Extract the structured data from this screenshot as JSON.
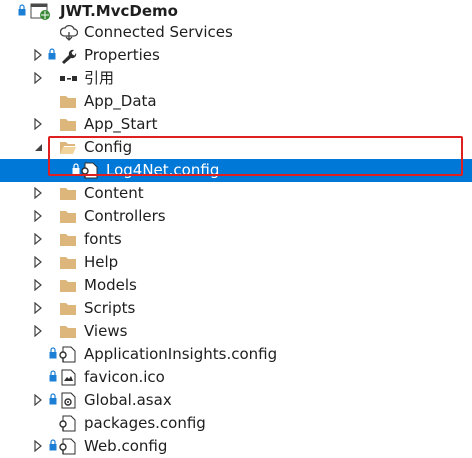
{
  "tree": {
    "root": "JWT.MvcDemo",
    "items": [
      {
        "label": "Connected Services",
        "icon": "connected-services-icon"
      },
      {
        "label": "Properties",
        "icon": "wrench-icon"
      },
      {
        "label": "引用",
        "icon": "references-icon"
      },
      {
        "label": "App_Data",
        "icon": "folder-icon"
      },
      {
        "label": "App_Start",
        "icon": "folder-icon"
      },
      {
        "label": "Config",
        "icon": "folder-open-icon",
        "expanded": true
      },
      {
        "label": "Log4Net.config",
        "icon": "config-file-icon",
        "selected": true
      },
      {
        "label": "Content",
        "icon": "folder-icon"
      },
      {
        "label": "Controllers",
        "icon": "folder-icon"
      },
      {
        "label": "fonts",
        "icon": "folder-icon"
      },
      {
        "label": "Help",
        "icon": "folder-icon"
      },
      {
        "label": "Models",
        "icon": "folder-icon"
      },
      {
        "label": "Scripts",
        "icon": "folder-icon"
      },
      {
        "label": "Views",
        "icon": "folder-icon"
      },
      {
        "label": "ApplicationInsights.config",
        "icon": "config-file-icon"
      },
      {
        "label": "favicon.ico",
        "icon": "image-file-icon"
      },
      {
        "label": "Global.asax",
        "icon": "asax-file-icon"
      },
      {
        "label": "packages.config",
        "icon": "config-file-icon"
      },
      {
        "label": "Web.config",
        "icon": "config-file-icon"
      }
    ]
  },
  "colors": {
    "selection": "#0078d7",
    "highlight_border": "#e02020",
    "folder": "#dcb67a",
    "lock": "#1c7fd6"
  }
}
